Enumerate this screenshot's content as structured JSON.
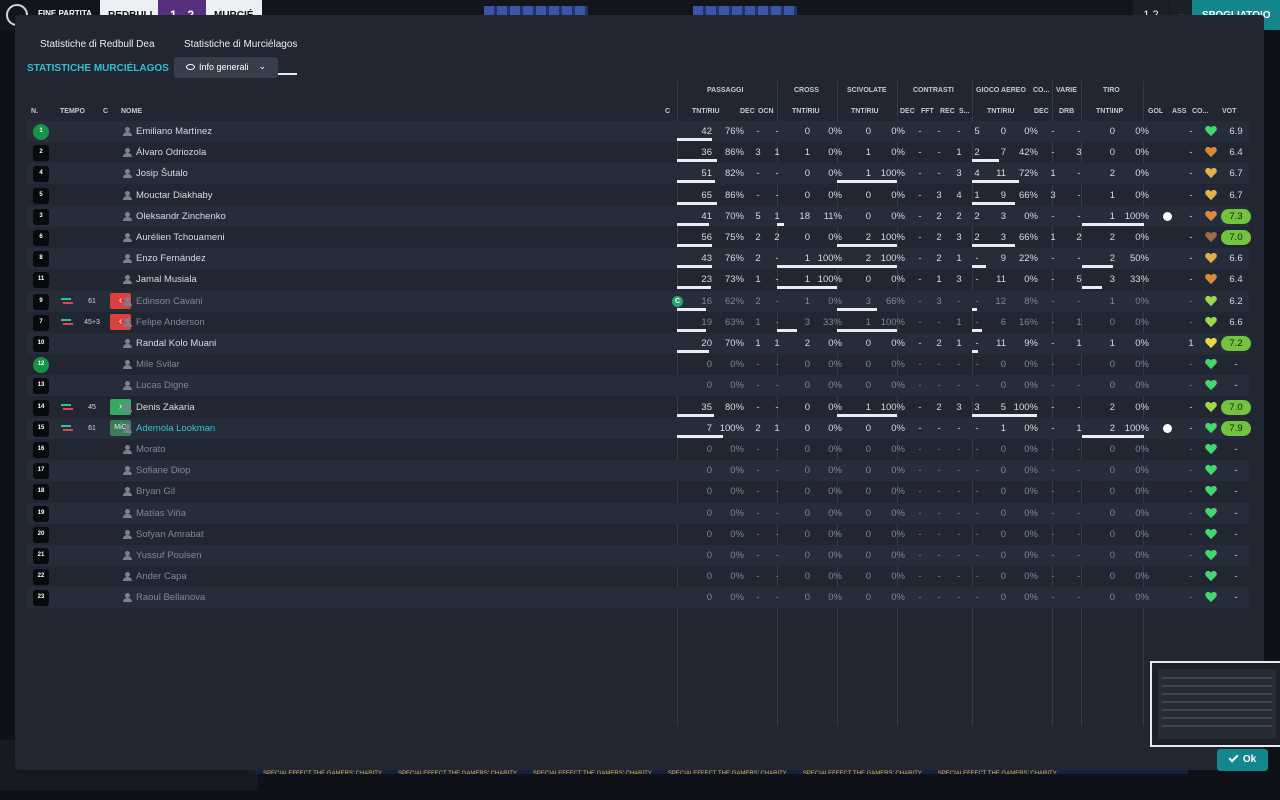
{
  "background": {
    "match_status": "FINE PARTITA",
    "team1": "REDBULL",
    "score": "1 - 2",
    "team2": "MURCIÉ",
    "counter": "1 2",
    "action_button": "SPOGLIATOIO",
    "sponsor": "SPECIALEFFECT THE GAMERS' CHARITY"
  },
  "tabs": [
    {
      "label": "Statistiche di Redbull Dea",
      "active": false
    },
    {
      "label": "Statistiche di Murciélagos",
      "active": true
    }
  ],
  "section_title": "STATISTICHE MURCIÉLAGOS",
  "view_dropdown": {
    "value": "Info generali",
    "icon": "eye-icon"
  },
  "group_headers": [
    "PASSAGGI",
    "CROSS",
    "SCIVOLATE",
    "CONTRASTI",
    "GIOCO AEREO",
    "CO...",
    "VARIE",
    "TIRO"
  ],
  "column_headers": {
    "num": "N.",
    "time": "TEMPO",
    "c1": "C",
    "name": "NOME",
    "c2": "C",
    "pass_tnt": "TNT/RIU",
    "pass_dec": "DEC",
    "pass_ocn": "OCN",
    "cross": "TNT/RIU",
    "tackle": "TNT/RIU",
    "cont_dec": "DEC",
    "cont_fft": "FFT",
    "cont_rec": "REC",
    "cont_s": "S...",
    "air": "TNT/RIU",
    "co_dec": "DEC",
    "drb": "DRB",
    "shot": "TNT\\INP",
    "gol": "GOL",
    "ass": "ASS",
    "co": "CO...",
    "vot": "VOT"
  },
  "players": [
    {
      "num": "1",
      "gk": true,
      "time": "",
      "chip": "",
      "name": "Emiliano Martínez",
      "dim": false,
      "link": false,
      "cap": false,
      "pt": "42",
      "pp": "76%",
      "pf": 0.76,
      "pd": "-",
      "po": "-",
      "ct": "0",
      "cp": "0%",
      "cf": 0,
      "st": "0",
      "sp": "0%",
      "sf": 0,
      "k1": "-",
      "k2": "-",
      "k3": "-",
      "k4": "5",
      "at": "0",
      "ap": "0%",
      "af": 0,
      "cd": "-",
      "dr": "-",
      "tt": "0",
      "tp": "0%",
      "tf": 0,
      "gol": false,
      "ass": "-",
      "heart": "#44d672",
      "vot": "6.9",
      "hl": false
    },
    {
      "num": "2",
      "gk": false,
      "time": "",
      "chip": "",
      "name": "Álvaro Odriozola",
      "dim": false,
      "link": false,
      "cap": false,
      "pt": "36",
      "pp": "86%",
      "pf": 0.86,
      "pd": "3",
      "po": "1",
      "ct": "1",
      "cp": "0%",
      "cf": 0,
      "st": "1",
      "sp": "0%",
      "sf": 0,
      "k1": "-",
      "k2": "-",
      "k3": "1",
      "k4": "2",
      "at": "7",
      "ap": "42%",
      "af": 0.42,
      "cd": "-",
      "dr": "3",
      "tt": "0",
      "tp": "0%",
      "tf": 0,
      "gol": false,
      "ass": "-",
      "heart": "#d98a3f",
      "vot": "6.4",
      "hl": false
    },
    {
      "num": "4",
      "gk": false,
      "time": "",
      "chip": "",
      "name": "Josip Šutalo",
      "dim": false,
      "link": false,
      "cap": false,
      "pt": "51",
      "pp": "82%",
      "pf": 0.82,
      "pd": "-",
      "po": "-",
      "ct": "0",
      "cp": "0%",
      "cf": 0,
      "st": "1",
      "sp": "100%",
      "sf": 1,
      "k1": "-",
      "k2": "-",
      "k3": "3",
      "k4": "4",
      "at": "11",
      "ap": "72%",
      "af": 0.72,
      "cd": "1",
      "dr": "-",
      "tt": "2",
      "tp": "0%",
      "tf": 0,
      "gol": false,
      "ass": "-",
      "heart": "#e0b24c",
      "vot": "6.7",
      "hl": false
    },
    {
      "num": "5",
      "gk": false,
      "time": "",
      "chip": "",
      "name": "Mouctar Diakhaby",
      "dim": false,
      "link": false,
      "cap": false,
      "pt": "65",
      "pp": "86%",
      "pf": 0.86,
      "pd": "-",
      "po": "-",
      "ct": "0",
      "cp": "0%",
      "cf": 0,
      "st": "0",
      "sp": "0%",
      "sf": 0,
      "k1": "-",
      "k2": "3",
      "k3": "4",
      "k4": "1",
      "at": "9",
      "ap": "66%",
      "af": 0.66,
      "cd": "3",
      "dr": "-",
      "tt": "1",
      "tp": "0%",
      "tf": 0,
      "gol": false,
      "ass": "-",
      "heart": "#e0b24c",
      "vot": "6.7",
      "hl": false
    },
    {
      "num": "3",
      "gk": false,
      "time": "",
      "chip": "",
      "name": "Oleksandr Zinchenko",
      "dim": false,
      "link": false,
      "cap": false,
      "pt": "41",
      "pp": "70%",
      "pf": 0.7,
      "pd": "5",
      "po": "1",
      "ct": "18",
      "cp": "11%",
      "cf": 0.11,
      "st": "0",
      "sp": "0%",
      "sf": 0,
      "k1": "-",
      "k2": "2",
      "k3": "2",
      "k4": "2",
      "at": "3",
      "ap": "0%",
      "af": 0,
      "cd": "-",
      "dr": "-",
      "tt": "1",
      "tp": "100%",
      "tf": 1,
      "gol": true,
      "ass": "-",
      "heart": "#d98a3f",
      "vot": "7.3",
      "hl": true
    },
    {
      "num": "6",
      "gk": false,
      "time": "",
      "chip": "",
      "name": "Aurélien Tchouameni",
      "dim": false,
      "link": false,
      "cap": false,
      "pt": "56",
      "pp": "75%",
      "pf": 0.75,
      "pd": "2",
      "po": "2",
      "ct": "0",
      "cp": "0%",
      "cf": 0,
      "st": "2",
      "sp": "100%",
      "sf": 1,
      "k1": "-",
      "k2": "2",
      "k3": "3",
      "k4": "2",
      "at": "3",
      "ap": "66%",
      "af": 0.66,
      "cd": "1",
      "dr": "2",
      "tt": "2",
      "tp": "0%",
      "tf": 0,
      "gol": false,
      "ass": "-",
      "heart": "#9a6a4a",
      "vot": "7.0",
      "hl": true
    },
    {
      "num": "8",
      "gk": false,
      "time": "",
      "chip": "",
      "name": "Enzo Fernández",
      "dim": false,
      "link": false,
      "cap": false,
      "pt": "43",
      "pp": "76%",
      "pf": 0.76,
      "pd": "2",
      "po": "-",
      "ct": "1",
      "cp": "100%",
      "cf": 1,
      "st": "2",
      "sp": "100%",
      "sf": 1,
      "k1": "-",
      "k2": "2",
      "k3": "1",
      "k4": "-",
      "at": "9",
      "ap": "22%",
      "af": 0.22,
      "cd": "-",
      "dr": "-",
      "tt": "2",
      "tp": "50%",
      "tf": 0.5,
      "gol": false,
      "ass": "-",
      "heart": "#e0b24c",
      "vot": "6.6",
      "hl": false
    },
    {
      "num": "11",
      "gk": false,
      "time": "",
      "chip": "",
      "name": "Jamal Musiala",
      "dim": false,
      "link": false,
      "cap": false,
      "pt": "23",
      "pp": "73%",
      "pf": 0.73,
      "pd": "1",
      "po": "-",
      "ct": "1",
      "cp": "100%",
      "cf": 1,
      "st": "0",
      "sp": "0%",
      "sf": 0,
      "k1": "-",
      "k2": "1",
      "k3": "3",
      "k4": "-",
      "at": "11",
      "ap": "0%",
      "af": 0,
      "cd": "-",
      "dr": "5",
      "tt": "3",
      "tp": "33%",
      "tf": 0.33,
      "gol": false,
      "ass": "-",
      "heart": "#d98a3f",
      "vot": "6.4",
      "hl": false
    },
    {
      "num": "9",
      "gk": false,
      "time": "61",
      "chip": "out",
      "name": "Edinson Cavani",
      "dim": true,
      "link": false,
      "cap": true,
      "pt": "16",
      "pp": "62%",
      "pf": 0.62,
      "pd": "2",
      "po": "-",
      "ct": "1",
      "cp": "0%",
      "cf": 0,
      "st": "3",
      "sp": "66%",
      "sf": 0.66,
      "k1": "-",
      "k2": "3",
      "k3": "-",
      "k4": "-",
      "at": "12",
      "ap": "8%",
      "af": 0.08,
      "cd": "-",
      "dr": "-",
      "tt": "1",
      "tp": "0%",
      "tf": 0,
      "gol": false,
      "ass": "-",
      "heart": "#9bd94a",
      "vot": "6.2",
      "hl": false
    },
    {
      "num": "7",
      "gk": false,
      "time": "45+3",
      "chip": "out",
      "name": "Felipe Anderson",
      "dim": true,
      "link": false,
      "cap": false,
      "pt": "19",
      "pp": "63%",
      "pf": 0.63,
      "pd": "1",
      "po": "-",
      "ct": "3",
      "cp": "33%",
      "cf": 0.33,
      "st": "1",
      "sp": "100%",
      "sf": 1,
      "k1": "-",
      "k2": "-",
      "k3": "1",
      "k4": "-",
      "at": "6",
      "ap": "16%",
      "af": 0.16,
      "cd": "-",
      "dr": "1",
      "tt": "0",
      "tp": "0%",
      "tf": 0,
      "gol": false,
      "ass": "-",
      "heart": "#9bd94a",
      "vot": "6.6",
      "hl": false
    },
    {
      "num": "10",
      "gk": false,
      "time": "",
      "chip": "",
      "name": "Randal Kolo Muani",
      "dim": false,
      "link": false,
      "cap": false,
      "pt": "20",
      "pp": "70%",
      "pf": 0.7,
      "pd": "1",
      "po": "1",
      "ct": "2",
      "cp": "0%",
      "cf": 0,
      "st": "0",
      "sp": "0%",
      "sf": 0,
      "k1": "-",
      "k2": "2",
      "k3": "1",
      "k4": "-",
      "at": "11",
      "ap": "9%",
      "af": 0.09,
      "cd": "-",
      "dr": "1",
      "tt": "1",
      "tp": "0%",
      "tf": 0,
      "gol": false,
      "ass": "1",
      "heart": "#e6d94a",
      "vot": "7.2",
      "hl": true
    },
    {
      "num": "12",
      "gk": true,
      "time": "",
      "chip": "",
      "name": "Mile Svilar",
      "dim": true,
      "link": false,
      "cap": false,
      "pt": "0",
      "pp": "0%",
      "pf": 0,
      "pd": "-",
      "po": "-",
      "ct": "0",
      "cp": "0%",
      "cf": 0,
      "st": "0",
      "sp": "0%",
      "sf": 0,
      "k1": "-",
      "k2": "-",
      "k3": "-",
      "k4": "-",
      "at": "0",
      "ap": "0%",
      "af": 0,
      "cd": "-",
      "dr": "-",
      "tt": "0",
      "tp": "0%",
      "tf": 0,
      "gol": false,
      "ass": "-",
      "heart": "#44d672",
      "vot": "-",
      "hl": false
    },
    {
      "num": "13",
      "gk": false,
      "time": "",
      "chip": "",
      "name": "Lucas Digne",
      "dim": true,
      "link": false,
      "cap": false,
      "pt": "0",
      "pp": "0%",
      "pf": 0,
      "pd": "-",
      "po": "-",
      "ct": "0",
      "cp": "0%",
      "cf": 0,
      "st": "0",
      "sp": "0%",
      "sf": 0,
      "k1": "-",
      "k2": "-",
      "k3": "-",
      "k4": "-",
      "at": "0",
      "ap": "0%",
      "af": 0,
      "cd": "-",
      "dr": "-",
      "tt": "0",
      "tp": "0%",
      "tf": 0,
      "gol": false,
      "ass": "-",
      "heart": "#44d672",
      "vot": "-",
      "hl": false
    },
    {
      "num": "14",
      "gk": false,
      "time": "45",
      "chip": "in",
      "name": "Denis Zakaria",
      "dim": false,
      "link": false,
      "cap": false,
      "pt": "35",
      "pp": "80%",
      "pf": 0.8,
      "pd": "-",
      "po": "-",
      "ct": "0",
      "cp": "0%",
      "cf": 0,
      "st": "1",
      "sp": "100%",
      "sf": 1,
      "k1": "-",
      "k2": "2",
      "k3": "3",
      "k4": "3",
      "at": "5",
      "ap": "100%",
      "af": 1,
      "cd": "-",
      "dr": "-",
      "tt": "2",
      "tp": "0%",
      "tf": 0,
      "gol": false,
      "ass": "-",
      "heart": "#9bd94a",
      "vot": "7.0",
      "hl": true
    },
    {
      "num": "15",
      "gk": false,
      "time": "61",
      "chip": "mic",
      "name": "Ademola Lookman",
      "dim": false,
      "link": true,
      "cap": false,
      "pt": "7",
      "pp": "100%",
      "pf": 1,
      "pd": "2",
      "po": "1",
      "ct": "0",
      "cp": "0%",
      "cf": 0,
      "st": "0",
      "sp": "0%",
      "sf": 0,
      "k1": "-",
      "k2": "-",
      "k3": "-",
      "k4": "-",
      "at": "1",
      "ap": "0%",
      "af": 0,
      "cd": "-",
      "dr": "1",
      "tt": "2",
      "tp": "100%",
      "tf": 1,
      "gol": true,
      "ass": "-",
      "heart": "#44d672",
      "vot": "7.9",
      "hl": true
    },
    {
      "num": "16",
      "gk": false,
      "time": "",
      "chip": "",
      "name": "Morato",
      "dim": true,
      "link": false,
      "cap": false,
      "pt": "0",
      "pp": "0%",
      "pf": 0,
      "pd": "-",
      "po": "-",
      "ct": "0",
      "cp": "0%",
      "cf": 0,
      "st": "0",
      "sp": "0%",
      "sf": 0,
      "k1": "-",
      "k2": "-",
      "k3": "-",
      "k4": "-",
      "at": "0",
      "ap": "0%",
      "af": 0,
      "cd": "-",
      "dr": "-",
      "tt": "0",
      "tp": "0%",
      "tf": 0,
      "gol": false,
      "ass": "-",
      "heart": "#44d672",
      "vot": "-",
      "hl": false
    },
    {
      "num": "17",
      "gk": false,
      "time": "",
      "chip": "",
      "name": "Sofiane Diop",
      "dim": true,
      "link": false,
      "cap": false,
      "pt": "0",
      "pp": "0%",
      "pf": 0,
      "pd": "-",
      "po": "-",
      "ct": "0",
      "cp": "0%",
      "cf": 0,
      "st": "0",
      "sp": "0%",
      "sf": 0,
      "k1": "-",
      "k2": "-",
      "k3": "-",
      "k4": "-",
      "at": "0",
      "ap": "0%",
      "af": 0,
      "cd": "-",
      "dr": "-",
      "tt": "0",
      "tp": "0%",
      "tf": 0,
      "gol": false,
      "ass": "-",
      "heart": "#44d672",
      "vot": "-",
      "hl": false
    },
    {
      "num": "18",
      "gk": false,
      "time": "",
      "chip": "",
      "name": "Bryan Gil",
      "dim": true,
      "link": false,
      "cap": false,
      "pt": "0",
      "pp": "0%",
      "pf": 0,
      "pd": "-",
      "po": "-",
      "ct": "0",
      "cp": "0%",
      "cf": 0,
      "st": "0",
      "sp": "0%",
      "sf": 0,
      "k1": "-",
      "k2": "-",
      "k3": "-",
      "k4": "-",
      "at": "0",
      "ap": "0%",
      "af": 0,
      "cd": "-",
      "dr": "-",
      "tt": "0",
      "tp": "0%",
      "tf": 0,
      "gol": false,
      "ass": "-",
      "heart": "#44d672",
      "vot": "-",
      "hl": false
    },
    {
      "num": "19",
      "gk": false,
      "time": "",
      "chip": "",
      "name": "Matías Viña",
      "dim": true,
      "link": false,
      "cap": false,
      "pt": "0",
      "pp": "0%",
      "pf": 0,
      "pd": "-",
      "po": "-",
      "ct": "0",
      "cp": "0%",
      "cf": 0,
      "st": "0",
      "sp": "0%",
      "sf": 0,
      "k1": "-",
      "k2": "-",
      "k3": "-",
      "k4": "-",
      "at": "0",
      "ap": "0%",
      "af": 0,
      "cd": "-",
      "dr": "-",
      "tt": "0",
      "tp": "0%",
      "tf": 0,
      "gol": false,
      "ass": "-",
      "heart": "#44d672",
      "vot": "-",
      "hl": false
    },
    {
      "num": "20",
      "gk": false,
      "time": "",
      "chip": "",
      "name": "Sofyan Amrabat",
      "dim": true,
      "link": false,
      "cap": false,
      "pt": "0",
      "pp": "0%",
      "pf": 0,
      "pd": "-",
      "po": "-",
      "ct": "0",
      "cp": "0%",
      "cf": 0,
      "st": "0",
      "sp": "0%",
      "sf": 0,
      "k1": "-",
      "k2": "-",
      "k3": "-",
      "k4": "-",
      "at": "0",
      "ap": "0%",
      "af": 0,
      "cd": "-",
      "dr": "-",
      "tt": "0",
      "tp": "0%",
      "tf": 0,
      "gol": false,
      "ass": "-",
      "heart": "#44d672",
      "vot": "-",
      "hl": false
    },
    {
      "num": "21",
      "gk": false,
      "time": "",
      "chip": "",
      "name": "Yussuf Poulsen",
      "dim": true,
      "link": false,
      "cap": false,
      "pt": "0",
      "pp": "0%",
      "pf": 0,
      "pd": "-",
      "po": "-",
      "ct": "0",
      "cp": "0%",
      "cf": 0,
      "st": "0",
      "sp": "0%",
      "sf": 0,
      "k1": "-",
      "k2": "-",
      "k3": "-",
      "k4": "-",
      "at": "0",
      "ap": "0%",
      "af": 0,
      "cd": "-",
      "dr": "-",
      "tt": "0",
      "tp": "0%",
      "tf": 0,
      "gol": false,
      "ass": "-",
      "heart": "#44d672",
      "vot": "-",
      "hl": false
    },
    {
      "num": "22",
      "gk": false,
      "time": "",
      "chip": "",
      "name": "Ander Capa",
      "dim": true,
      "link": false,
      "cap": false,
      "pt": "0",
      "pp": "0%",
      "pf": 0,
      "pd": "-",
      "po": "-",
      "ct": "0",
      "cp": "0%",
      "cf": 0,
      "st": "0",
      "sp": "0%",
      "sf": 0,
      "k1": "-",
      "k2": "-",
      "k3": "-",
      "k4": "-",
      "at": "0",
      "ap": "0%",
      "af": 0,
      "cd": "-",
      "dr": "-",
      "tt": "0",
      "tp": "0%",
      "tf": 0,
      "gol": false,
      "ass": "-",
      "heart": "#44d672",
      "vot": "-",
      "hl": false
    },
    {
      "num": "23",
      "gk": false,
      "time": "",
      "chip": "",
      "name": "Raoul Bellanova",
      "dim": true,
      "link": false,
      "cap": false,
      "pt": "0",
      "pp": "0%",
      "pf": 0,
      "pd": "-",
      "po": "-",
      "ct": "0",
      "cp": "0%",
      "cf": 0,
      "st": "0",
      "sp": "0%",
      "sf": 0,
      "k1": "-",
      "k2": "-",
      "k3": "-",
      "k4": "-",
      "at": "0",
      "ap": "0%",
      "af": 0,
      "cd": "-",
      "dr": "-",
      "tt": "0",
      "tp": "0%",
      "tf": 0,
      "gol": false,
      "ass": "-",
      "heart": "#44d672",
      "vot": "-",
      "hl": false
    }
  ],
  "ok_button": "Ok"
}
